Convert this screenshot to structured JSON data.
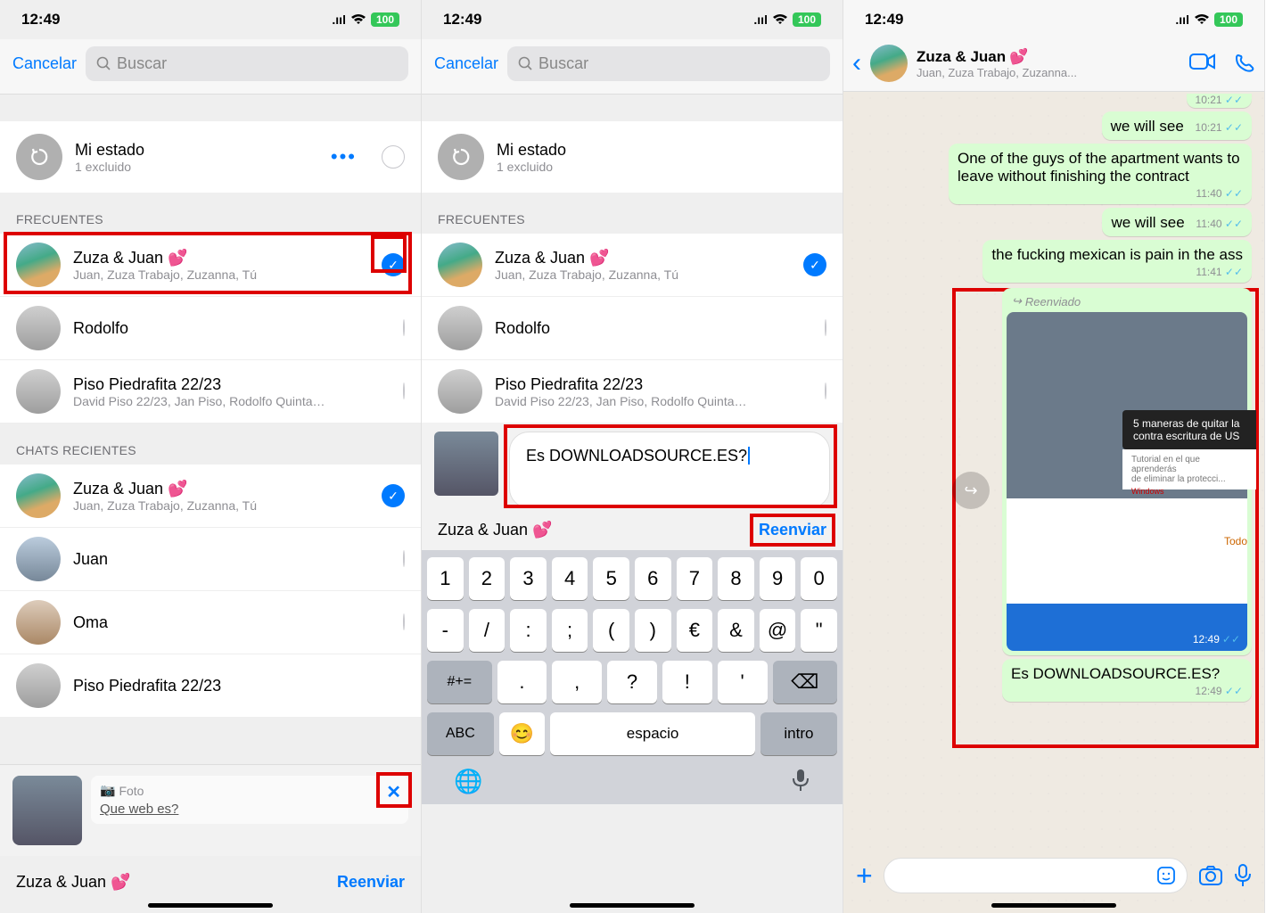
{
  "status": {
    "time": "12:49",
    "battery": "100"
  },
  "panel1": {
    "cancel": "Cancelar",
    "search_placeholder": "Buscar",
    "mystatus": {
      "title": "Mi estado",
      "subtitle": "1 excluido"
    },
    "sec_frequent": "FRECUENTES",
    "frequent": [
      {
        "name": "Zuza & Juan",
        "emoji": "💕",
        "sub": "Juan, Zuza Trabajo, Zuzanna, Tú",
        "checked": true
      },
      {
        "name": "Rodolfo",
        "sub": "",
        "checked": false
      },
      {
        "name": "Piso Piedrafita 22/23",
        "sub": "David Piso 22/23, Jan Piso, Rodolfo Quintana...",
        "checked": false
      }
    ],
    "sec_recent": "CHATS RECIENTES",
    "recent": [
      {
        "name": "Zuza & Juan",
        "emoji": "💕",
        "sub": "Juan, Zuza Trabajo, Zuzanna, Tú",
        "checked": true
      },
      {
        "name": "Juan"
      },
      {
        "name": "Oma"
      },
      {
        "name": "Piso Piedrafita 22/23"
      }
    ],
    "reply": {
      "label": "Foto",
      "question": "Que web es?"
    },
    "forward": {
      "to": "Zuza & Juan",
      "emoji": "💕",
      "action": "Reenviar"
    }
  },
  "panel2": {
    "caption": "Es DOWNLOADSOURCE.ES?",
    "to": "Zuza & Juan",
    "emoji": "💕",
    "action": "Reenviar",
    "keys_r1": [
      "1",
      "2",
      "3",
      "4",
      "5",
      "6",
      "7",
      "8",
      "9",
      "0"
    ],
    "keys_r2": [
      "-",
      "/",
      ":",
      ";",
      "(",
      ")",
      "€",
      "&",
      "@",
      "\""
    ],
    "keys_r3": [
      "#+=",
      ".",
      ",",
      "?",
      "!",
      "'",
      "⌫"
    ],
    "keys_r4": {
      "abc": "ABC",
      "emoji": "😊",
      "space": "espacio",
      "intro": "intro"
    }
  },
  "panel3": {
    "title": "Zuza & Juan",
    "emoji": "💕",
    "sub": "Juan, Zuza Trabajo, Zuzanna...",
    "msgs": [
      {
        "text": "we will see",
        "time": "10:21"
      },
      {
        "text": "One of the guys of the apartment wants to leave without finishing the contract",
        "time": "11:40"
      },
      {
        "text": "we will see",
        "time": "11:40"
      },
      {
        "text": "the fucking mexican is pain in the ass",
        "time": "11:41"
      }
    ],
    "fwd_label": "Reenviado",
    "img_title": "5 maneras de quitar la",
    "img_title2": "contra escritura de US",
    "img_sub": "Tutorial en el que aprenderás",
    "img_sub2": "de eliminar la protecci...",
    "img_cat": "Windows",
    "img_todo": "Todo",
    "img_time": "12:49",
    "caption_msg": "Es DOWNLOADSOURCE.ES?",
    "caption_time": "12:49",
    "cut_time": "10:21"
  }
}
